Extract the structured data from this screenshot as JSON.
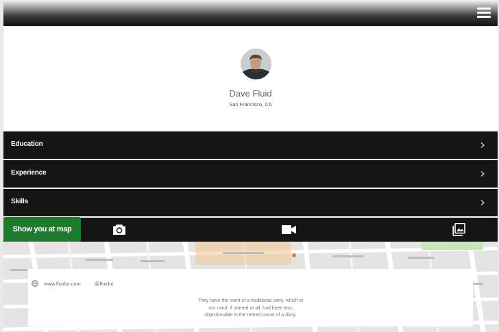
{
  "profile": {
    "name": "Dave Fluid",
    "location": "San Francisco, CA"
  },
  "menu": {
    "items": [
      {
        "label": "Education"
      },
      {
        "label": "Experience"
      },
      {
        "label": "Skills"
      }
    ]
  },
  "toolbar": {
    "map_button_label": "Show you at map",
    "icons": [
      "camera-icon",
      "video-camera-icon",
      "photo-library-icon"
    ]
  },
  "info": {
    "website": "www.fluidui.com",
    "handle": "@fluidui",
    "quote_lines": [
      "They have the merit of a traditional piety, which to",
      "our mind, if uttered at all, had been less",
      "objectionable in the retired closet of a diary."
    ]
  },
  "colors": {
    "header_dark": "#141414",
    "menu_bg": "#151515",
    "accent_green": "#1f7a2e",
    "map_road_orange": "#f0c890",
    "map_park_green": "#c8e6b8"
  }
}
